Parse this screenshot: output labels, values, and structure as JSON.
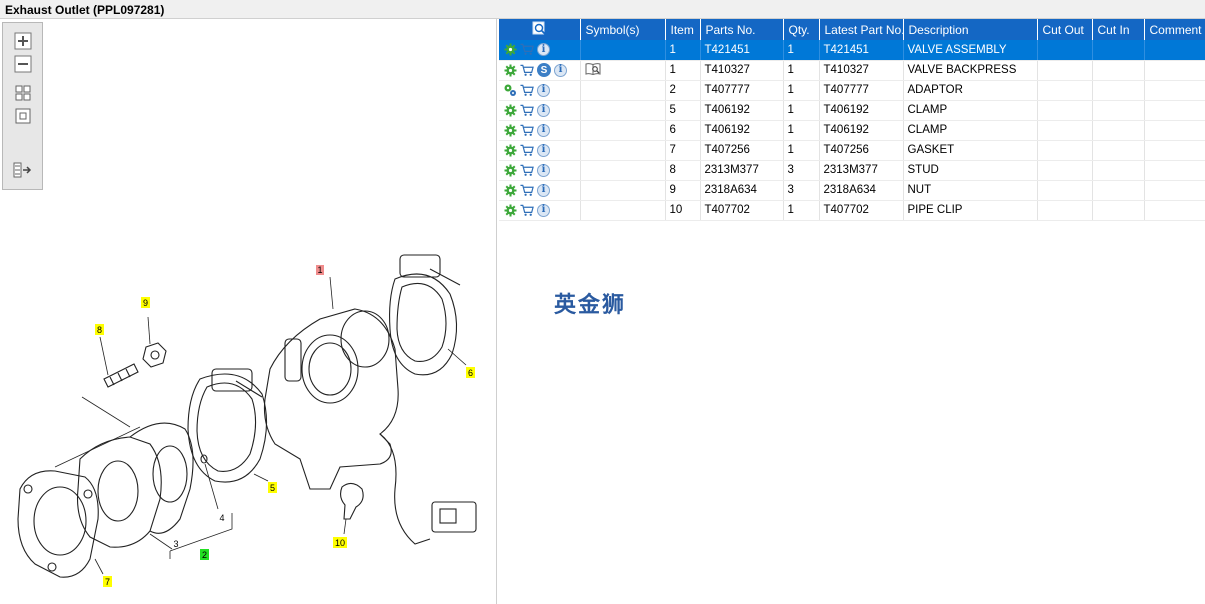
{
  "window": {
    "title": "Exhaust Outlet (PPL097281)"
  },
  "toolbar": {
    "buttons": [
      {
        "name": "zoom-in-button",
        "icon": "zoom-in-icon"
      },
      {
        "name": "zoom-out-button",
        "icon": "zoom-out-icon"
      },
      {
        "name": "fit-all-button",
        "icon": "fit-all-icon"
      },
      {
        "name": "fit-page-button",
        "icon": "fit-page-icon"
      },
      {
        "name": "toggle-panel-button",
        "icon": "panel-arrow-icon"
      }
    ]
  },
  "diagram": {
    "callouts": [
      {
        "label": "1",
        "color": "#f08c8c"
      },
      {
        "label": "2",
        "color": "#22e022"
      },
      {
        "label": "3",
        "color": "none"
      },
      {
        "label": "4",
        "color": "none"
      },
      {
        "label": "5",
        "color": "#ffff00"
      },
      {
        "label": "6",
        "color": "#ffff00"
      },
      {
        "label": "7",
        "color": "#ffff00"
      },
      {
        "label": "8",
        "color": "#ffff00"
      },
      {
        "label": "9",
        "color": "#ffff00"
      },
      {
        "label": "10",
        "color": "#ffff00"
      }
    ]
  },
  "table": {
    "columns": [
      "",
      "Symbol(s)",
      "Item",
      "Parts No.",
      "Qty.",
      "Latest Part No.",
      "Description",
      "Cut Out",
      "Cut In",
      "Comment"
    ],
    "header_icon": "search-doc-icon",
    "rows": [
      {
        "item": "1",
        "part_no": "T421451",
        "qty": "1",
        "latest": "T421451",
        "desc": "VALVE ASSEMBLY",
        "cut_out": "",
        "cut_in": "",
        "comment": "",
        "selected": true,
        "s_icon": false,
        "symbol": ""
      },
      {
        "item": "1",
        "part_no": "T410327",
        "qty": "1",
        "latest": "T410327",
        "desc": "VALVE BACKPRESS",
        "cut_out": "",
        "cut_in": "",
        "comment": "",
        "selected": false,
        "s_icon": true,
        "symbol": "book-search-icon"
      },
      {
        "item": "2",
        "part_no": "T407777",
        "qty": "1",
        "latest": "T407777",
        "desc": "ADAPTOR",
        "cut_out": "",
        "cut_in": "",
        "comment": "",
        "selected": false,
        "s_icon": false,
        "symbol": "",
        "gear_variant": "gears-icon"
      },
      {
        "item": "5",
        "part_no": "T406192",
        "qty": "1",
        "latest": "T406192",
        "desc": "CLAMP",
        "cut_out": "",
        "cut_in": "",
        "comment": "",
        "selected": false,
        "s_icon": false,
        "symbol": ""
      },
      {
        "item": "6",
        "part_no": "T406192",
        "qty": "1",
        "latest": "T406192",
        "desc": "CLAMP",
        "cut_out": "",
        "cut_in": "",
        "comment": "",
        "selected": false,
        "s_icon": false,
        "symbol": ""
      },
      {
        "item": "7",
        "part_no": "T407256",
        "qty": "1",
        "latest": "T407256",
        "desc": "GASKET",
        "cut_out": "",
        "cut_in": "",
        "comment": "",
        "selected": false,
        "s_icon": false,
        "symbol": ""
      },
      {
        "item": "8",
        "part_no": "2313M377",
        "qty": "3",
        "latest": "2313M377",
        "desc": "STUD",
        "cut_out": "",
        "cut_in": "",
        "comment": "",
        "selected": false,
        "s_icon": false,
        "symbol": ""
      },
      {
        "item": "9",
        "part_no": "2318A634",
        "qty": "3",
        "latest": "2318A634",
        "desc": "NUT",
        "cut_out": "",
        "cut_in": "",
        "comment": "",
        "selected": false,
        "s_icon": false,
        "symbol": ""
      },
      {
        "item": "10",
        "part_no": "T407702",
        "qty": "1",
        "latest": "T407702",
        "desc": "PIPE CLIP",
        "cut_out": "",
        "cut_in": "",
        "comment": "",
        "selected": false,
        "s_icon": false,
        "symbol": ""
      }
    ]
  },
  "watermark": {
    "text": "英金狮"
  },
  "colors": {
    "header_blue": "#1467c4",
    "selected_blue": "#0078d7",
    "gear_green": "#3da83a",
    "cart_blue": "#2f6fb8"
  }
}
